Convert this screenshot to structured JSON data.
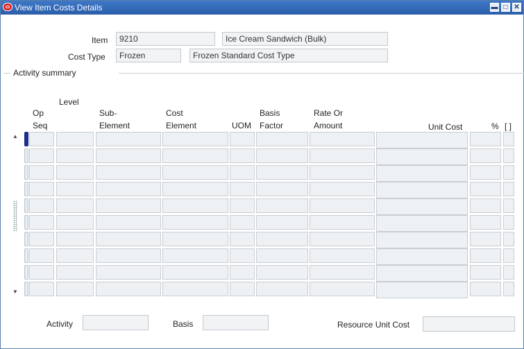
{
  "window": {
    "title": "View Item Costs Details"
  },
  "header": {
    "item_label": "Item",
    "item_value": "9210",
    "item_description": "Ice Cream Sandwich (Bulk)",
    "cost_type_label": "Cost Type",
    "cost_type_value": "Frozen",
    "cost_type_description": "Frozen Standard Cost Type"
  },
  "activity_summary": {
    "label": "Activity summary",
    "columns": {
      "level": "Level",
      "op_seq_1": "Op",
      "op_seq_2": "Seq",
      "sub_element_1": "Sub-",
      "sub_element_2": "Element",
      "cost_element_1": "Cost",
      "cost_element_2": "Element",
      "uom": "UOM",
      "basis_factor_1": "Basis",
      "basis_factor_2": "Factor",
      "rate_or_amount_1": "Rate Or",
      "rate_or_amount_2": "Amount",
      "unit_cost": "Unit Cost",
      "percent": "%",
      "descriptive_flex": "[ ]"
    },
    "row_count": 10
  },
  "footer": {
    "activity_label": "Activity",
    "activity_value": "",
    "basis_label": "Basis",
    "basis_value": "",
    "resource_unit_cost_label": "Resource Unit Cost",
    "resource_unit_cost_value": ""
  },
  "icons": {
    "app": "oracle-app-icon",
    "minimize": "minimize-icon",
    "maximize": "maximize-icon",
    "close": "close-icon",
    "scroll_up": "scroll-up-arrow-icon",
    "scroll_down": "scroll-down-arrow-icon"
  },
  "colors": {
    "titlebar": "#2a5ea8",
    "field_bg": "#f1f3f5",
    "active_row_indicator": "#1a2e8a"
  }
}
